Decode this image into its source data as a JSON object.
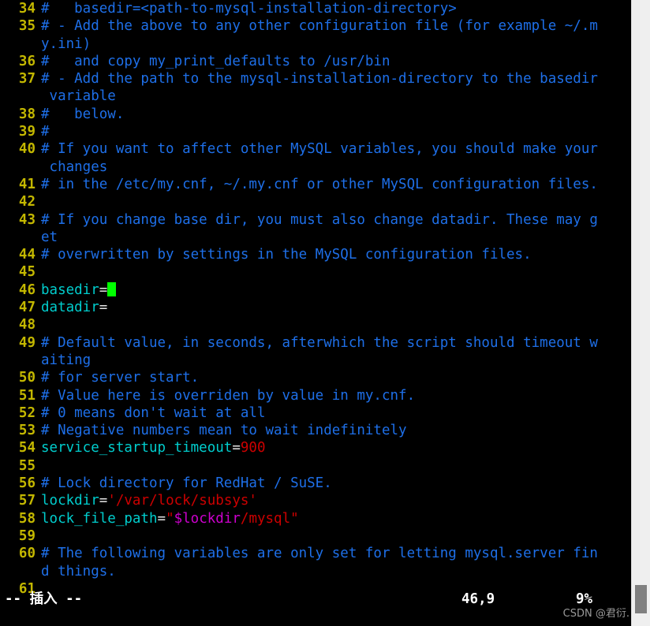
{
  "editor": {
    "app": "vim",
    "cursor_block_color": "#00ff00",
    "background": "#000000",
    "colors": {
      "line_number": "#c3b700",
      "comment": "#1e6fe8",
      "identifier": "#00cdcd",
      "operator": "#e6e6e6",
      "number": "#cd0000",
      "string": "#cd0000",
      "shell_variable": "#cd00cd"
    },
    "lines": [
      {
        "number": "34",
        "segments": [
          {
            "t": "#   basedir=<path-to-mysql-installation-directory>",
            "c": "comment"
          }
        ]
      },
      {
        "number": "35",
        "segments": [
          {
            "t": "# - Add the above to any other configuration file (for example ~/.m",
            "c": "comment"
          }
        ]
      },
      {
        "number": "",
        "segments": [
          {
            "t": "y.ini)",
            "c": "comment"
          }
        ]
      },
      {
        "number": "36",
        "segments": [
          {
            "t": "#   and copy my_print_defaults to /usr/bin",
            "c": "comment"
          }
        ]
      },
      {
        "number": "37",
        "segments": [
          {
            "t": "# - Add the path to the mysql-installation-directory to the basedir",
            "c": "comment"
          }
        ]
      },
      {
        "number": "",
        "segments": [
          {
            "t": " variable",
            "c": "comment"
          }
        ]
      },
      {
        "number": "38",
        "segments": [
          {
            "t": "#   below.",
            "c": "comment"
          }
        ]
      },
      {
        "number": "39",
        "segments": [
          {
            "t": "#",
            "c": "comment"
          }
        ]
      },
      {
        "number": "40",
        "segments": [
          {
            "t": "# If you want to affect other MySQL variables, you should make your",
            "c": "comment"
          }
        ]
      },
      {
        "number": "",
        "segments": [
          {
            "t": " changes",
            "c": "comment"
          }
        ]
      },
      {
        "number": "41",
        "segments": [
          {
            "t": "# in the /etc/my.cnf, ~/.my.cnf or other MySQL configuration files.",
            "c": "comment"
          }
        ]
      },
      {
        "number": "42",
        "segments": []
      },
      {
        "number": "43",
        "segments": [
          {
            "t": "# If you change base dir, you must also change datadir. These may g",
            "c": "comment"
          }
        ]
      },
      {
        "number": "",
        "segments": [
          {
            "t": "et",
            "c": "comment"
          }
        ]
      },
      {
        "number": "44",
        "segments": [
          {
            "t": "# overwritten by settings in the MySQL configuration files.",
            "c": "comment"
          }
        ]
      },
      {
        "number": "45",
        "segments": []
      },
      {
        "number": "46",
        "segments": [
          {
            "t": "basedir",
            "c": "ident"
          },
          {
            "t": "=",
            "c": "op"
          },
          {
            "t": "",
            "c": "cursor"
          }
        ]
      },
      {
        "number": "47",
        "segments": [
          {
            "t": "datadir",
            "c": "ident"
          },
          {
            "t": "=",
            "c": "op"
          }
        ]
      },
      {
        "number": "48",
        "segments": []
      },
      {
        "number": "49",
        "segments": [
          {
            "t": "# Default value, in seconds, afterwhich the script should timeout w",
            "c": "comment"
          }
        ]
      },
      {
        "number": "",
        "segments": [
          {
            "t": "aiting",
            "c": "comment"
          }
        ]
      },
      {
        "number": "50",
        "segments": [
          {
            "t": "# for server start.",
            "c": "comment"
          }
        ]
      },
      {
        "number": "51",
        "segments": [
          {
            "t": "# Value here is overriden by value in my.cnf.",
            "c": "comment"
          }
        ]
      },
      {
        "number": "52",
        "segments": [
          {
            "t": "# 0 means don't wait at all",
            "c": "comment"
          }
        ]
      },
      {
        "number": "53",
        "segments": [
          {
            "t": "# Negative numbers mean to wait indefinitely",
            "c": "comment"
          }
        ]
      },
      {
        "number": "54",
        "segments": [
          {
            "t": "service_startup_timeout",
            "c": "ident"
          },
          {
            "t": "=",
            "c": "op"
          },
          {
            "t": "900",
            "c": "num"
          }
        ]
      },
      {
        "number": "55",
        "segments": []
      },
      {
        "number": "56",
        "segments": [
          {
            "t": "# Lock directory for RedHat / SuSE.",
            "c": "comment"
          }
        ]
      },
      {
        "number": "57",
        "segments": [
          {
            "t": "lockdir",
            "c": "ident"
          },
          {
            "t": "=",
            "c": "op"
          },
          {
            "t": "'/var/lock/subsys'",
            "c": "str"
          }
        ]
      },
      {
        "number": "58",
        "segments": [
          {
            "t": "lock_file_path",
            "c": "ident"
          },
          {
            "t": "=",
            "c": "op"
          },
          {
            "t": "\"",
            "c": "str"
          },
          {
            "t": "$lockdir",
            "c": "var"
          },
          {
            "t": "/mysql\"",
            "c": "str"
          }
        ]
      },
      {
        "number": "59",
        "segments": []
      },
      {
        "number": "60",
        "segments": [
          {
            "t": "# The following variables are only set for letting mysql.server fin",
            "c": "comment"
          }
        ]
      },
      {
        "number": "",
        "segments": [
          {
            "t": "d things.",
            "c": "comment"
          }
        ]
      },
      {
        "number": "61",
        "segments": []
      }
    ]
  },
  "status": {
    "mode": "-- 插入 --",
    "position": "46,9",
    "percent": "9%"
  },
  "watermark": {
    "text": "CSDN @君衍."
  },
  "scrollbar": {
    "orientation": "vertical"
  }
}
